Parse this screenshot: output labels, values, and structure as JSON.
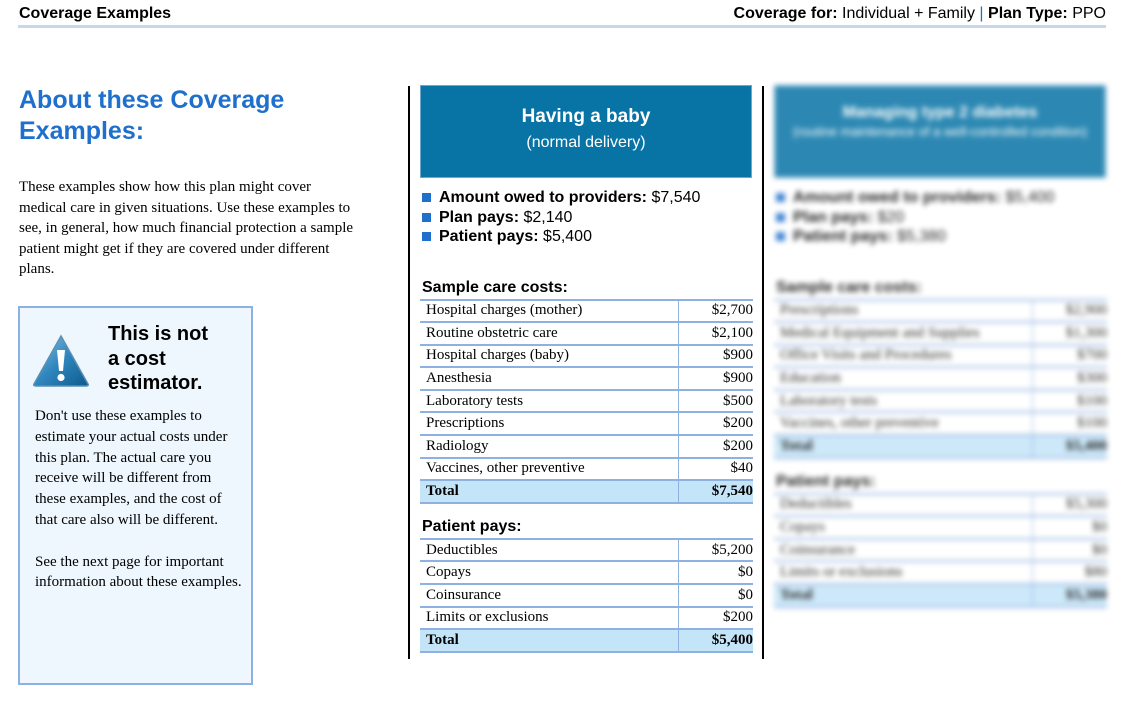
{
  "header": {
    "title": "Coverage Examples",
    "coverage_for_label": "Coverage for:",
    "coverage_for_value": "Individual + Family",
    "separator": "|",
    "plan_type_label": "Plan Type:",
    "plan_type_value": "PPO"
  },
  "about": {
    "title": "About these Coverage Examples:",
    "body": "These examples show how this plan might cover medical care in given situations. Use these examples to see, in general, how much financial protection a sample patient might get if they are covered under different plans."
  },
  "warning": {
    "icon": "warning-triangle-icon",
    "title_line1": "This is not",
    "title_line2": "a cost",
    "title_line3": "estimator.",
    "paragraph1": "Don't use these examples to estimate your actual costs under this plan. The actual care you receive will be different from these examples, and the cost of that care also will be different.",
    "paragraph2": "See the next page for important information about these examples."
  },
  "colors": {
    "accent_blue": "#1f6fcc",
    "header_blue": "#0874a6",
    "total_row": "#c4e5f8",
    "table_lines": "#8fb1e2",
    "warn_bg": "#edf7fd"
  },
  "examples": [
    {
      "title": "Having a baby",
      "subtitle": "(normal delivery)",
      "summary": [
        {
          "label": "Amount owed to providers:",
          "value": "$7,540"
        },
        {
          "label": "Plan pays:",
          "value": "$2,140"
        },
        {
          "label": "Patient pays:",
          "value": "$5,400"
        }
      ],
      "sample_costs_title": "Sample care costs:",
      "sample_costs": [
        {
          "item": "Hospital charges (mother)",
          "amount": "$2,700"
        },
        {
          "item": "Routine obstetric care",
          "amount": "$2,100"
        },
        {
          "item": "Hospital charges (baby)",
          "amount": "$900"
        },
        {
          "item": "Anesthesia",
          "amount": "$900"
        },
        {
          "item": "Laboratory tests",
          "amount": "$500"
        },
        {
          "item": "Prescriptions",
          "amount": "$200"
        },
        {
          "item": "Radiology",
          "amount": "$200"
        },
        {
          "item": "Vaccines, other preventive",
          "amount": "$40"
        }
      ],
      "sample_costs_total": {
        "item": "Total",
        "amount": "$7,540"
      },
      "patient_pays_title": "Patient pays:",
      "patient_pays": [
        {
          "item": "Deductibles",
          "amount": "$5,200"
        },
        {
          "item": "Copays",
          "amount": "$0"
        },
        {
          "item": "Coinsurance",
          "amount": "$0"
        },
        {
          "item": "Limits or exclusions",
          "amount": "$200"
        }
      ],
      "patient_pays_total": {
        "item": "Total",
        "amount": "$5,400"
      }
    },
    {
      "title": "Managing type 2 diabetes",
      "subtitle": "(routine maintenance of a well-controlled condition)",
      "summary": [
        {
          "label": "Amount owed to providers:",
          "value": "$5,400"
        },
        {
          "label": "Plan pays:",
          "value": "$20"
        },
        {
          "label": "Patient pays:",
          "value": "$5,380"
        }
      ],
      "sample_costs_title": "Sample care costs:",
      "sample_costs": [
        {
          "item": "Prescriptions",
          "amount": "$2,900"
        },
        {
          "item": "Medical Equipment and Supplies",
          "amount": "$1,300"
        },
        {
          "item": "Office Visits and Procedures",
          "amount": "$700"
        },
        {
          "item": "Education",
          "amount": "$300"
        },
        {
          "item": "Laboratory tests",
          "amount": "$100"
        },
        {
          "item": "Vaccines, other preventive",
          "amount": "$100"
        }
      ],
      "sample_costs_total": {
        "item": "Total",
        "amount": "$5,400"
      },
      "patient_pays_title": "Patient pays:",
      "patient_pays": [
        {
          "item": "Deductibles",
          "amount": "$5,300"
        },
        {
          "item": "Copays",
          "amount": "$0"
        },
        {
          "item": "Coinsurance",
          "amount": "$0"
        },
        {
          "item": "Limits or exclusions",
          "amount": "$80"
        }
      ],
      "patient_pays_total": {
        "item": "Total",
        "amount": "$5,380"
      }
    }
  ]
}
